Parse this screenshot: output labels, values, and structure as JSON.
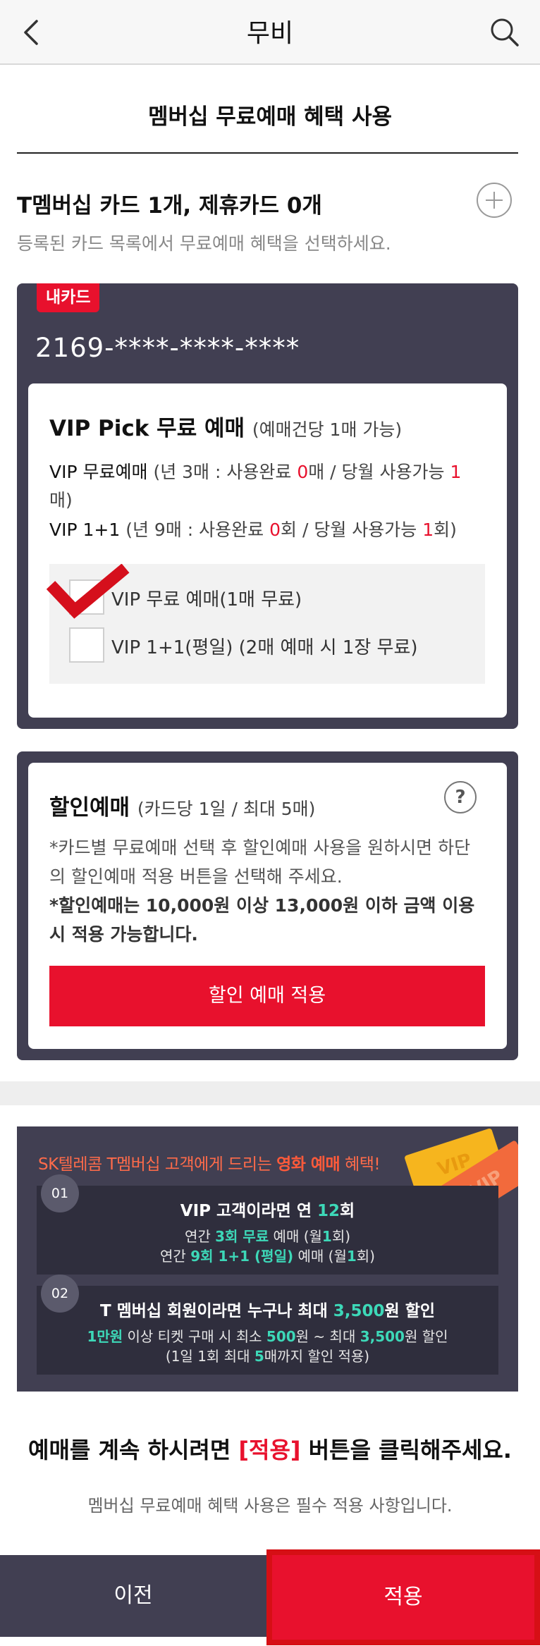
{
  "header": {
    "title": "무비",
    "back_icon": "chevron-left-icon",
    "search_icon": "search-icon"
  },
  "page_title": "멤버십 무료예매 혜택 사용",
  "cards": {
    "count_label": "T멤버십 카드 1개, 제휴카드 0개",
    "description": "등록된 카드 목록에서 무료예매 혜택을 선택하세요.",
    "add_icon": "plus-circle-icon"
  },
  "my_card": {
    "badge": "내카드",
    "number": "2169-****-****-****",
    "vip": {
      "title": "VIP Pick 무료 예매",
      "title_sub": "(예매건당 1매 가능)",
      "free_line": {
        "label": "VIP 무료예매",
        "prefix": "(년 3매 : 사용완료 ",
        "used": "0",
        "middle": "매 / 당월 사용가능 ",
        "available": "1",
        "suffix": "매)"
      },
      "oneplus_line": {
        "label": "VIP 1+1",
        "prefix": "(년 9매 : 사용완료 ",
        "used": "0",
        "middle": "회 / 당월 사용가능 ",
        "available": "1",
        "suffix": "회)"
      },
      "options": [
        {
          "label": "VIP 무료 예매(1매 무료)",
          "checked": true
        },
        {
          "label": "VIP 1+1(평일) (2매 예매 시 1장 무료)",
          "checked": false
        }
      ]
    }
  },
  "discount": {
    "title": "할인예매",
    "title_sub": "(카드당 1일 / 최대 5매)",
    "help": "?",
    "text1": "*카드별 무료예매 선택 후 할인예매 사용을 원하시면 하단의 할인예매 적용 버튼을 선택해 주세요.",
    "text2": "*할인예매는 10,000원 이상 13,000원 이하 금액 이용 시 적용 가능합니다.",
    "button": "할인 예매 적용"
  },
  "promo": {
    "title_prefix": "SK텔레콤 T멤버십 고객에게 드리는 ",
    "title_highlight": "영화 예매",
    "title_suffix": " 혜택!",
    "ticket_text": "VIP",
    "items": [
      {
        "num": "01",
        "headline_a": "VIP 고객이라면 연 ",
        "headline_b": "12",
        "headline_c": "회",
        "line1_a": "연간 ",
        "line1_b": "3회 무료",
        "line1_c": " 예매 (월",
        "line1_d": "1",
        "line1_e": "회)",
        "line2_a": "연간 ",
        "line2_b": "9회 1+1 (평일)",
        "line2_c": " 예매 (월",
        "line2_d": "1",
        "line2_e": "회)"
      },
      {
        "num": "02",
        "headline_a": "T 멤버십 회원이라면 누구나 최대 ",
        "headline_b": "3,500",
        "headline_c": "원 할인",
        "line1_a": "1만원",
        "line1_b": " 이상 티켓 구매 시 최소 ",
        "line1_c": "500",
        "line1_d": "원 ~ 최대 ",
        "line1_e": "3,500",
        "line1_f": "원 할인",
        "line2_a": "(1일 1회 최대 ",
        "line2_b": "5",
        "line2_c": "매까지 할인 적용)"
      }
    ]
  },
  "notice": {
    "prefix": "예매를 계속 하시려면 ",
    "highlight": "[적용]",
    "suffix": " 버튼을 클릭해주세요.",
    "sub": "멤버십 무료예매 혜택 사용은 필수 적용 사항입니다."
  },
  "footer": {
    "prev": "이전",
    "apply": "적용"
  },
  "colors": {
    "accent_red": "#e8112d",
    "panel_dark": "#413f52",
    "teal": "#3dd8b8"
  }
}
